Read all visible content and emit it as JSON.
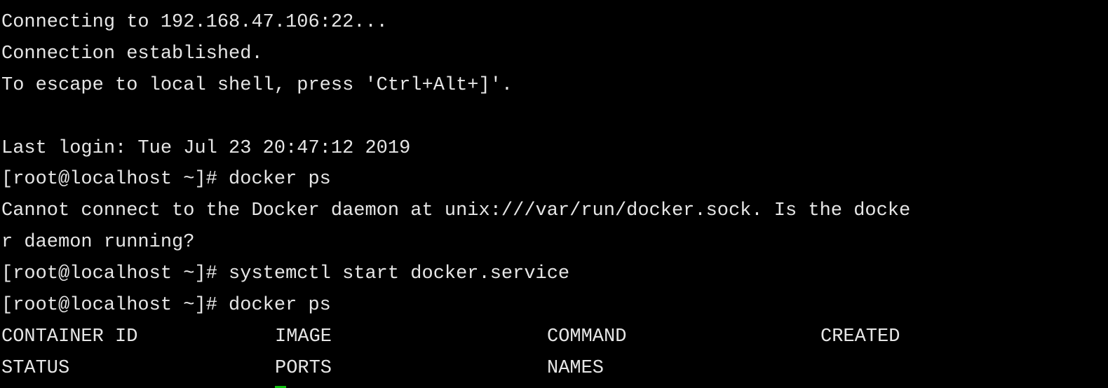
{
  "terminal": {
    "lines": [
      "Connecting to 192.168.47.106:22...",
      "Connection established.",
      "To escape to local shell, press 'Ctrl+Alt+]'.",
      "",
      "Last login: Tue Jul 23 20:47:12 2019",
      "[root@localhost ~]# docker ps",
      "Cannot connect to the Docker daemon at unix:///var/run/docker.sock. Is the docke",
      "r daemon running?",
      "[root@localhost ~]# systemctl start docker.service",
      "[root@localhost ~]# docker ps"
    ],
    "table_header_row1": [
      "CONTAINER ID",
      "IMAGE",
      "COMMAND",
      "CREATED"
    ],
    "table_header_row2": [
      "STATUS",
      "PORTS",
      "NAMES"
    ],
    "cursor_color": "#10c010"
  }
}
